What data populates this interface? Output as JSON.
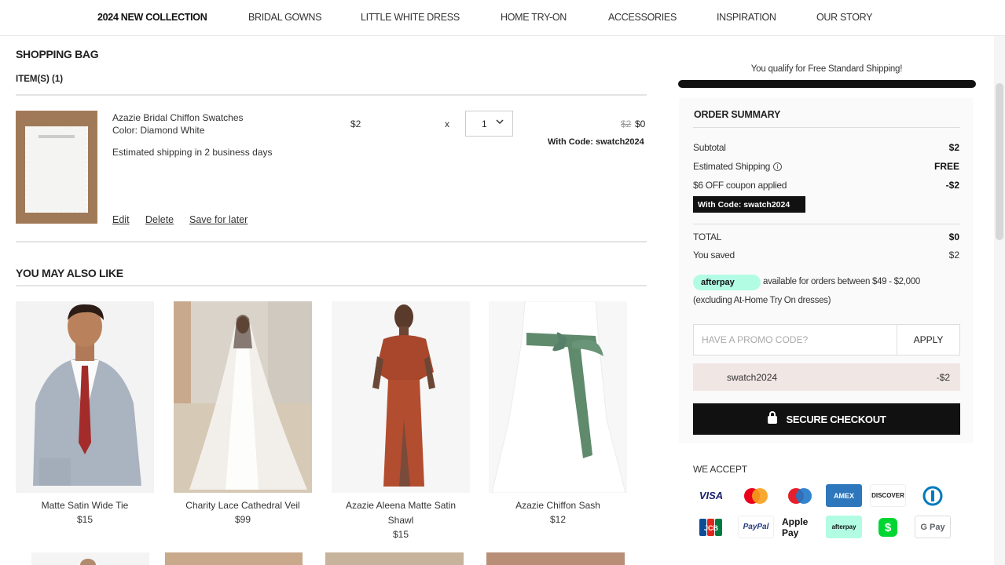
{
  "nav": {
    "items": [
      "2024 NEW COLLECTION",
      "BRIDAL GOWNS",
      "LITTLE WHITE DRESS",
      "HOME TRY-ON",
      "ACCESSORIES",
      "INSPIRATION",
      "OUR STORY"
    ]
  },
  "bag": {
    "title": "SHOPPING BAG",
    "items_count": "ITEM(S) (1)",
    "item": {
      "name": "Azazie Bridal Chiffon Swatches",
      "color": "Color: Diamond White",
      "shipping": "Estimated shipping in 2 business days",
      "price": "$2",
      "qty_x": "x",
      "qty": "1",
      "old_price": "$2",
      "new_price": "$0",
      "with_code": "With Code: swatch2024",
      "actions": [
        "Edit",
        "Delete",
        "Save for later"
      ]
    }
  },
  "recommendations": {
    "title": "YOU MAY ALSO LIKE",
    "items": [
      {
        "name": "Matte Satin Wide Tie",
        "price": "$15"
      },
      {
        "name": "Charity Lace Cathedral Veil",
        "price": "$99"
      },
      {
        "name": "Azazie Aleena Matte Satin Shawl",
        "price": "$15"
      },
      {
        "name": "Azazie Chiffon Sash",
        "price": "$12"
      }
    ]
  },
  "summary": {
    "free_shipping": "You qualify for Free Standard Shipping!",
    "title": "ORDER SUMMARY",
    "rows": [
      {
        "label": "Subtotal",
        "value": "$2"
      },
      {
        "label": "Estimated Shipping",
        "value": "FREE"
      },
      {
        "label": "$6 OFF coupon applied",
        "value": "-$2"
      }
    ],
    "code_tag": "With Code: swatch2024",
    "total_label": "TOTAL",
    "total_value": "$0",
    "saved_label": "You saved",
    "saved_value": "$2",
    "afterpay_logo": "afterpay",
    "afterpay_text": "available for orders between $49 - $2,000",
    "afterpay_text2": "(excluding At-Home Try On dresses)",
    "promo_placeholder": "HAVE A PROMO CODE?",
    "apply_label": "APPLY",
    "applied_code": "swatch2024",
    "applied_value": "-$2",
    "checkout_label": "SECURE CHECKOUT",
    "we_accept": "WE ACCEPT",
    "payments": [
      "VISA",
      "Mastercard",
      "Maestro",
      "AMEX",
      "DISCOVER",
      "Diners Club",
      "JCB",
      "PayPal",
      "Apple Pay",
      "afterpay",
      "Cash App",
      "G Pay"
    ]
  },
  "colors": {
    "accent": "#111111",
    "afterpay_mint": "#b2fce4",
    "applied_code_bg": "#f0e6e4"
  }
}
